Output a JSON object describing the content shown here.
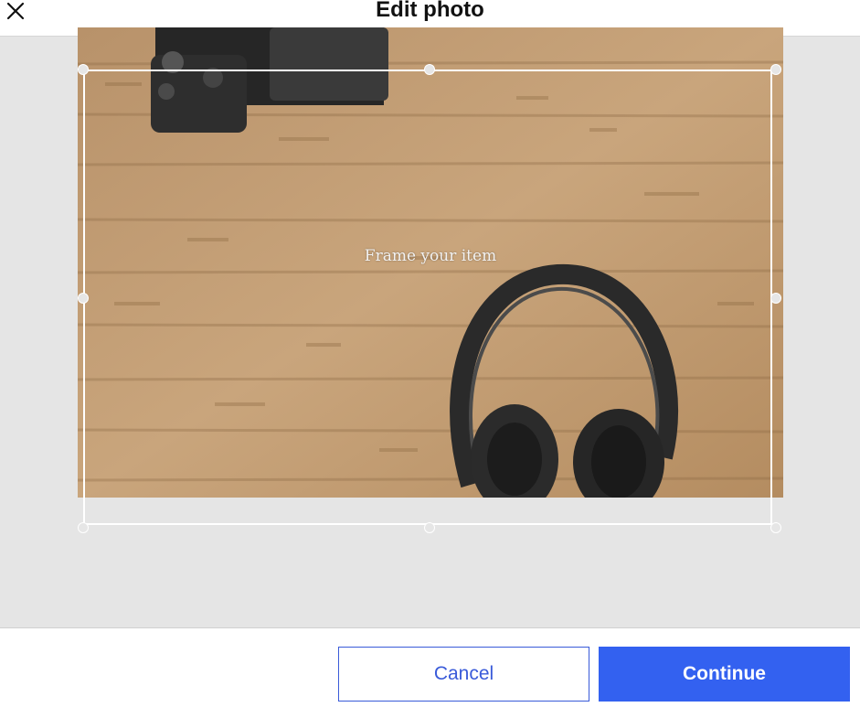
{
  "header": {
    "title": "Edit photo",
    "close_icon": "close-icon"
  },
  "editor": {
    "hint": "Frame your item",
    "photo_description_icons": [
      "camera",
      "headphones"
    ]
  },
  "footer": {
    "cancel_label": "Cancel",
    "continue_label": "Continue"
  },
  "colors": {
    "accent": "#3361f0",
    "cancel_text": "#3a5bd9",
    "editor_bg": "#e5e5e5"
  }
}
